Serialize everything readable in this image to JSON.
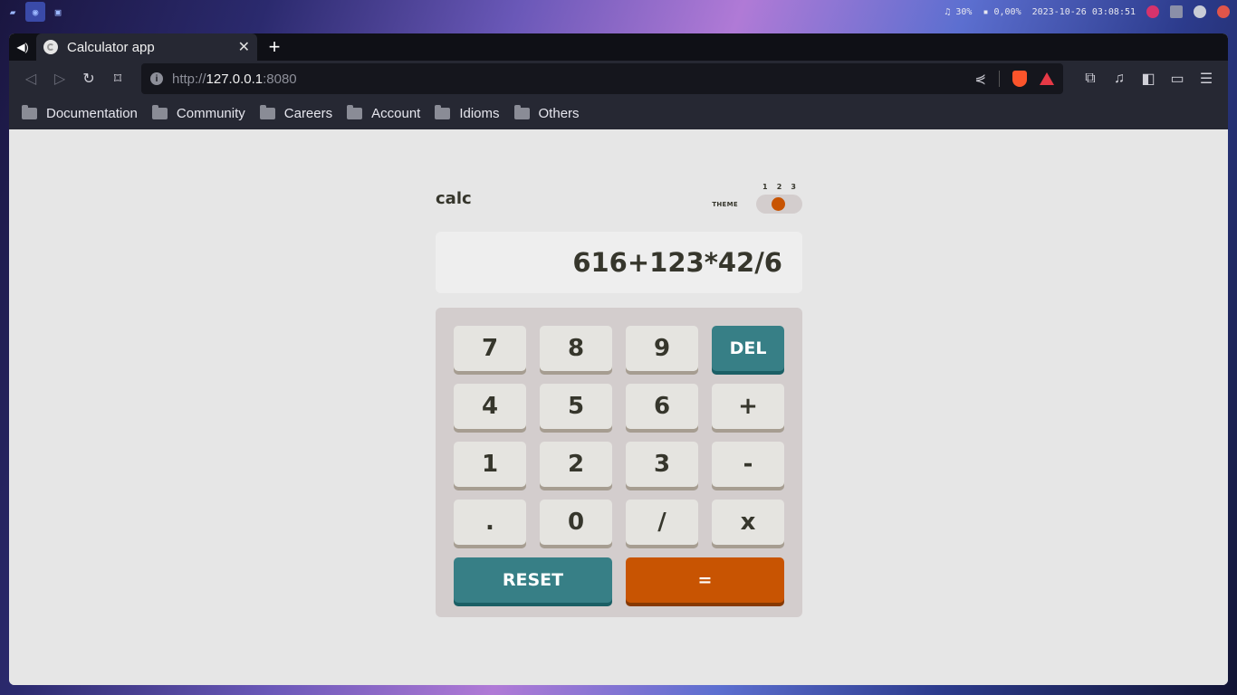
{
  "system_bar": {
    "volume": "30%",
    "network": "0,00%",
    "datetime": "2023-10-26 03:08:51"
  },
  "browser": {
    "tab": {
      "title": "Calculator app"
    },
    "url": {
      "scheme": "http://",
      "host": "127.0.0.1",
      "port": ":8080"
    },
    "bookmarks": [
      {
        "label": "Documentation"
      },
      {
        "label": "Community"
      },
      {
        "label": "Careers"
      },
      {
        "label": "Account"
      },
      {
        "label": "Idioms"
      },
      {
        "label": "Others"
      }
    ]
  },
  "calculator": {
    "logo": "calc",
    "theme_label": "THEME",
    "theme_options": [
      "1",
      "2",
      "3"
    ],
    "selected_theme": "2",
    "display": "616+123*42/6",
    "keys": [
      [
        "7",
        "8",
        "9",
        "DEL"
      ],
      [
        "4",
        "5",
        "6",
        "+"
      ],
      [
        "1",
        "2",
        "3",
        "-"
      ],
      [
        ".",
        "0",
        "/",
        "x"
      ]
    ],
    "reset_label": "RESET",
    "equals_label": "=",
    "colors": {
      "accent_orange": "#c85402",
      "accent_teal": "#377f86",
      "key_bg": "#e5e4e0",
      "text": "#36362c"
    }
  }
}
